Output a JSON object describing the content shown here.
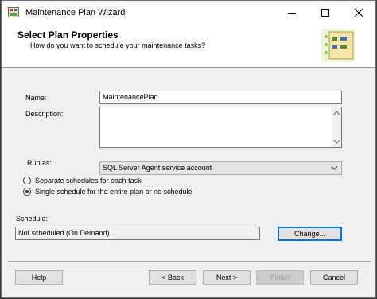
{
  "window": {
    "title": "Maintenance Plan Wizard"
  },
  "header": {
    "title": "Select Plan Properties",
    "subtitle": "How do you want to schedule your maintenance tasks?"
  },
  "form": {
    "name_label": "Name:",
    "name_value": "MaintenancePlan",
    "description_label": "Description:",
    "description_value": "",
    "run_as_label": "Run as:",
    "run_as_value": "SQL Server Agent service account",
    "radio_separate": "Separate schedules for each task",
    "radio_single": "Single schedule for the entire plan or no schedule",
    "radio_selected": "single",
    "schedule_label": "Schedule:",
    "schedule_value": "Not scheduled (On Demand)",
    "change_button": "Change..."
  },
  "footer": {
    "help": "Help",
    "back": "< Back",
    "next": "Next >",
    "finish": "Finish",
    "cancel": "Cancel"
  },
  "colors": {
    "accent": "#0078d7",
    "window_bg": "#f0f0f0",
    "header_bg": "#ffffff"
  },
  "icons": {
    "app": "maintenance-plan-icon",
    "minimize": "minimize-icon",
    "maximize": "maximize-icon",
    "close": "close-icon",
    "wizard": "wizard-graphic-icon",
    "dropdown": "chevron-down-icon"
  }
}
